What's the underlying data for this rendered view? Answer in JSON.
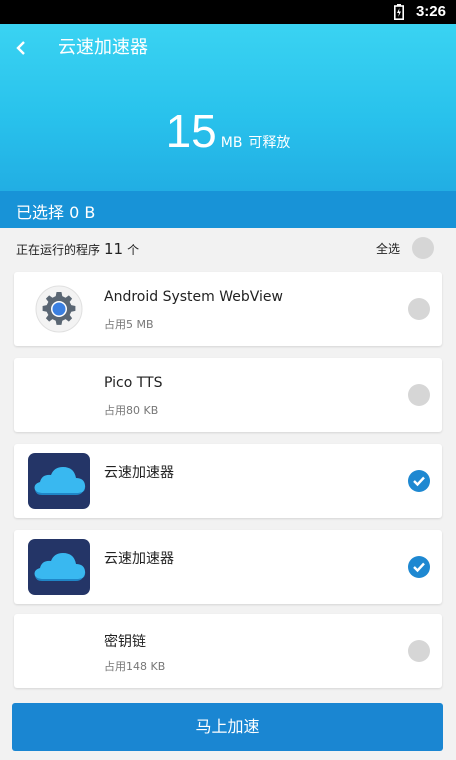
{
  "status_bar": {
    "time": "3:26"
  },
  "header": {
    "title": "云速加速器"
  },
  "summary": {
    "amount": "15",
    "unit": "MB",
    "suffix": "可释放"
  },
  "selection": {
    "text": "已选择 0 B"
  },
  "list": {
    "running_prefix": "正在运行的程序",
    "running_count": "11",
    "running_suffix": "个",
    "select_all": "全选"
  },
  "apps": [
    {
      "name": "Android System WebView",
      "size": "占用5 MB",
      "checked": false,
      "icon": "gear-icon"
    },
    {
      "name": "Pico TTS",
      "size": "占用80 KB",
      "checked": false,
      "icon": ""
    },
    {
      "name": "云速加速器",
      "size": "",
      "checked": true,
      "icon": "cloud-icon"
    },
    {
      "name": "云速加速器",
      "size": "",
      "checked": true,
      "icon": "cloud-icon"
    },
    {
      "name": "密钥链",
      "size": "占用148 KB",
      "checked": false,
      "icon": ""
    }
  ],
  "action": {
    "label": "马上加速"
  },
  "colors": {
    "hero_top": "#3ad3f2",
    "hero_bottom": "#1ea4df",
    "selection_bar": "#1893d7",
    "accent": "#1e88d1",
    "button": "#1a86d2"
  }
}
